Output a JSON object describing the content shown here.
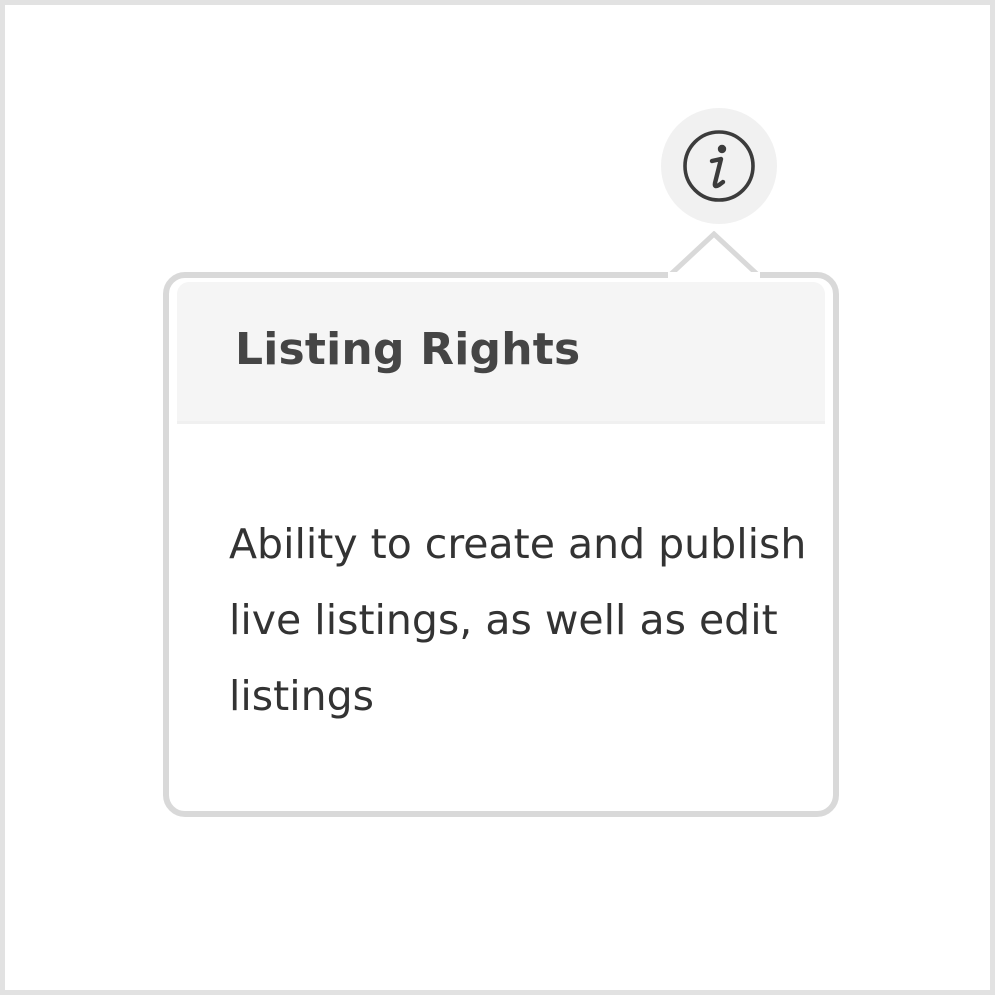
{
  "tooltip": {
    "icon": "info-icon",
    "title": "Listing Rights",
    "body": "Ability to create and publish live listings, as well as edit listings"
  },
  "colors": {
    "icon_stroke": "#3c3c3c",
    "icon_background": "#f1f1f1",
    "popover_border": "#d9d9d9",
    "header_background": "#f5f5f5",
    "title_text": "#454545",
    "body_text": "#333333"
  }
}
